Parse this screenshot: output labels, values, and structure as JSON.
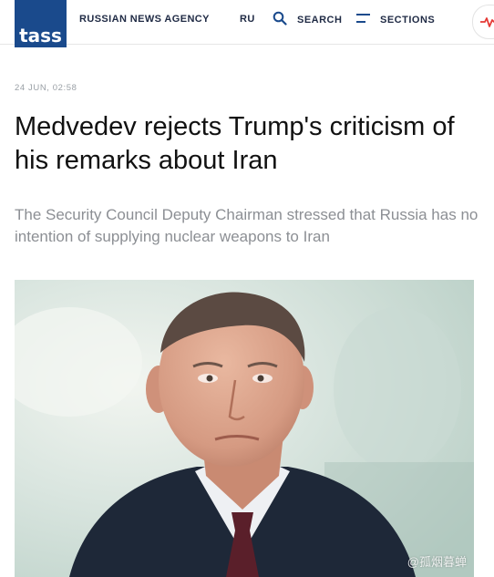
{
  "header": {
    "logo_text": "tass",
    "agency_name": "RUSSIAN NEWS AGENCY",
    "language": "RU",
    "search_label": "SEARCH",
    "sections_label": "SECTIONS"
  },
  "article": {
    "dateline": "24 JUN, 02:58",
    "headline": "Medvedev rejects Trump's criticism of his remarks about Iran",
    "lead": "The Security Council Deputy Chairman stressed that Russia has no intention of supplying nuclear weapons to Iran"
  },
  "photo": {
    "watermark": "@孤烟暮蝉"
  },
  "colors": {
    "brand": "#1a4a8c",
    "headline": "#111111",
    "lead": "#8c8f94",
    "pulse": "#e53935"
  }
}
